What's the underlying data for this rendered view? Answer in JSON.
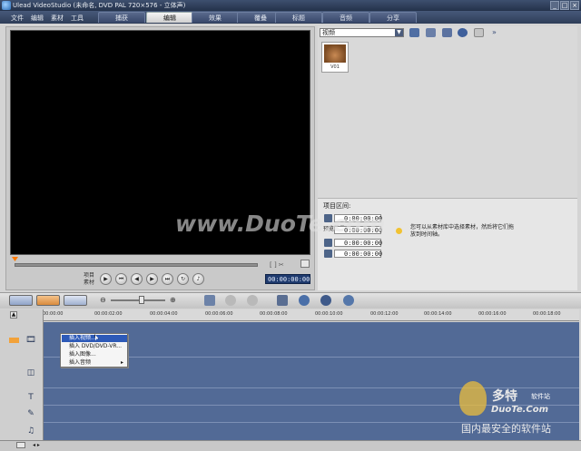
{
  "window": {
    "title": "Ulead VideoStudio (未命名, DVD PAL 720×576 - 立体声)",
    "buttons": [
      "_",
      "□",
      "×"
    ]
  },
  "menu": [
    "文件",
    "编辑",
    "素材",
    "工具"
  ],
  "steps": {
    "tabs": [
      "捕获",
      "编辑",
      "效果",
      "覆叠",
      "标题",
      "音频",
      "分享"
    ],
    "active": "编辑"
  },
  "library": {
    "category": "视频",
    "items": [
      {
        "caption": "V01"
      }
    ]
  },
  "options": {
    "duration_label": "项目区间:",
    "duration": "0:00:00:00",
    "preview_label": "预览数量:",
    "preview_value": "0:00:00:00",
    "start_value": "0:00:00:00",
    "end_value": "0:00:00:00",
    "hint": "您可以从素材库中选择素材，然后将它们拖放到时间轴。"
  },
  "transport": {
    "mode_labels": [
      "项目",
      "素材"
    ],
    "timecode": "00:00:00:00"
  },
  "timeline": {
    "ticks": [
      "00:00:00",
      "00:00:02:00",
      "00:00:04:00",
      "00:00:06:00",
      "00:00:08:00",
      "00:00:10:00",
      "00:00:12:00",
      "00:00:14:00",
      "00:00:16:00",
      "00:00:18:00"
    ]
  },
  "context_menu": {
    "items": [
      "插入视频...",
      "插入 DVD/DVD-VR...",
      "插入图像...",
      "插入音频"
    ]
  },
  "watermark": {
    "main": "www.DuoTe.com",
    "brand": "多特",
    "brand_small": "软件站",
    "domain": "DuoTe.Com",
    "slogan": "国内最安全的软件站"
  },
  "colors": {
    "accent": "#2d5ab8",
    "track_bg": "#526a96",
    "title_bar": "#24324a"
  }
}
